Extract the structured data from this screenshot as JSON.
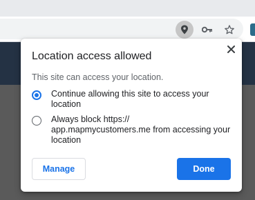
{
  "toolbar": {
    "icons": [
      "location-icon",
      "key-icon",
      "star-icon",
      "extension-icon"
    ]
  },
  "dialog": {
    "title": "Location access allowed",
    "description": "This site can access your location.",
    "options": [
      {
        "label": "Continue allowing this site to access your location",
        "selected": true
      },
      {
        "label": "Always block https://\napp.mapmycustomers.me from accessing your location",
        "selected": false
      }
    ],
    "manage_label": "Manage",
    "done_label": "Done"
  },
  "colors": {
    "accent": "#1a73e8",
    "page_header": "#243244",
    "backdrop": "#5a5a5a"
  }
}
